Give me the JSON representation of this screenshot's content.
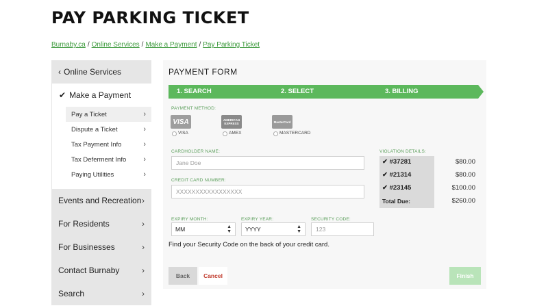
{
  "page": {
    "title": "PAY PARKING TICKET"
  },
  "breadcrumb": [
    "Burnaby.ca",
    "Online Services",
    "Make a Payment",
    "Pay Parking Ticket"
  ],
  "sidebar": {
    "back_label": "Online Services",
    "section_label": "Make a Payment",
    "sub_items": [
      "Pay a Ticket",
      "Dispute a Ticket",
      "Tax Payment Info",
      "Tax Deferment Info",
      "Paying Utilities"
    ],
    "categories": [
      "Events and Recreation",
      "For Residents",
      "For Businesses",
      "Contact Burnaby",
      "Search"
    ]
  },
  "form": {
    "title": "PAYMENT FORM",
    "steps": [
      "1. SEARCH",
      "2. SELECT",
      "3. BILLING"
    ],
    "payment_method_label": "PAYMENT METHOD:",
    "methods": [
      {
        "icon_text": "VISA",
        "label": "VISA",
        "color": "#9e9e9e"
      },
      {
        "icon_text": "AMERICAN EXPRESS",
        "label": "AMEX",
        "color": "#8a8a8a"
      },
      {
        "icon_text": "MasterCard",
        "label": "MASTERCARD",
        "color": "#9a9a9a"
      }
    ],
    "cardholder_label": "CARDHOLDER NAME:",
    "cardholder_placeholder": "Jane Doe",
    "card_number_label": "CREDIT CARD NUMBER:",
    "card_number_placeholder": "XXXXXXXXXXXXXXXXX",
    "expiry_month_label": "EXPIRY MONTH:",
    "expiry_month_value": "MM",
    "expiry_year_label": "EXPIRY YEAR:",
    "expiry_year_value": "YYYY",
    "security_label": "SECURITY CODE:",
    "security_placeholder": "123",
    "hint": "Find your Security Code on the back of your credit card.",
    "violation_label": "VIOLATION DETAILS:",
    "violations": [
      {
        "id": "#37281",
        "amount": "$80.00"
      },
      {
        "id": "#21314",
        "amount": "$80.00"
      },
      {
        "id": "#23145",
        "amount": "$100.00"
      }
    ],
    "total_label": "Total Due:",
    "total_amount": "$260.00",
    "back_label": "Back",
    "cancel_label": "Cancel",
    "finish_label": "Finish"
  },
  "colors": {
    "accent_green": "#5cb85c",
    "link_green": "#3d9a3d",
    "cancel_red": "#c0392b"
  }
}
